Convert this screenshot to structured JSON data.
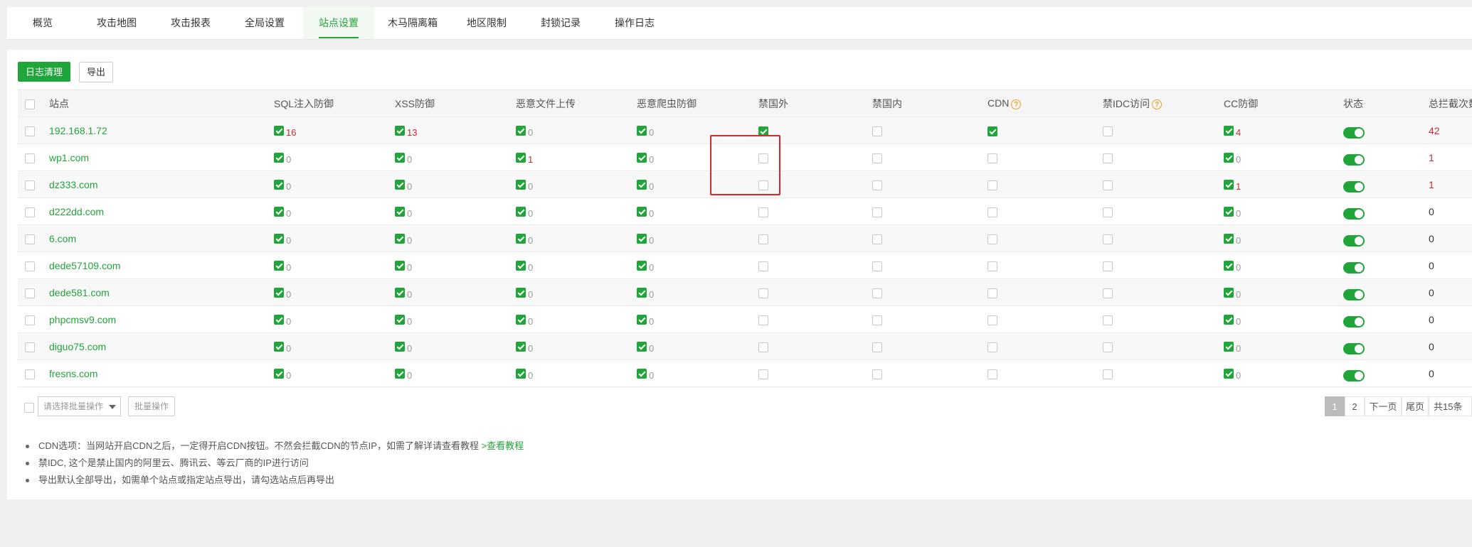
{
  "tabs": [
    "概览",
    "攻击地图",
    "攻击报表",
    "全局设置",
    "站点设置",
    "木马隔离箱",
    "地区限制",
    "封锁记录",
    "操作日志"
  ],
  "active_tab": 4,
  "toolbar": {
    "clear_logs": "日志清理",
    "export": "导出"
  },
  "table": {
    "headers": {
      "site": "站点",
      "sql": "SQL注入防御",
      "xss": "XSS防御",
      "upload": "恶意文件上传",
      "crawler": "恶意爬虫防御",
      "ban_foreign": "禁国外",
      "ban_domestic": "禁国内",
      "cdn": "CDN",
      "ban_idc": "禁IDC访问",
      "cc": "CC防御",
      "status": "状态",
      "total": "总拦截次数"
    },
    "rows": [
      {
        "site": "192.168.1.72",
        "sql": "16",
        "xss": "13",
        "upload": "0",
        "crawler": "0",
        "ban_foreign": true,
        "cdn": true,
        "cc": "4",
        "total": "42"
      },
      {
        "site": "wp1.com",
        "sql": "0",
        "xss": "0",
        "upload": "1",
        "crawler": "0",
        "ban_foreign": false,
        "cdn": false,
        "cc": "0",
        "total": "1"
      },
      {
        "site": "dz333.com",
        "sql": "0",
        "xss": "0",
        "upload": "0",
        "crawler": "0",
        "ban_foreign": false,
        "cdn": false,
        "cc": "1",
        "total": "1"
      },
      {
        "site": "d222dd.com",
        "sql": "0",
        "xss": "0",
        "upload": "0",
        "crawler": "0",
        "ban_foreign": false,
        "cdn": false,
        "cc": "0",
        "total": "0"
      },
      {
        "site": "6.com",
        "sql": "0",
        "xss": "0",
        "upload": "0",
        "crawler": "0",
        "ban_foreign": false,
        "cdn": false,
        "cc": "0",
        "total": "0"
      },
      {
        "site": "dede57109.com",
        "sql": "0",
        "xss": "0",
        "upload": "0",
        "crawler": "0",
        "ban_foreign": false,
        "cdn": false,
        "cc": "0",
        "total": "0"
      },
      {
        "site": "dede581.com",
        "sql": "0",
        "xss": "0",
        "upload": "0",
        "crawler": "0",
        "ban_foreign": false,
        "cdn": false,
        "cc": "0",
        "total": "0"
      },
      {
        "site": "phpcmsv9.com",
        "sql": "0",
        "xss": "0",
        "upload": "0",
        "crawler": "0",
        "ban_foreign": false,
        "cdn": false,
        "cc": "0",
        "total": "0"
      },
      {
        "site": "diguo75.com",
        "sql": "0",
        "xss": "0",
        "upload": "0",
        "crawler": "0",
        "ban_foreign": false,
        "cdn": false,
        "cc": "0",
        "total": "0"
      },
      {
        "site": "fresns.com",
        "sql": "0",
        "xss": "0",
        "upload": "0",
        "crawler": "0",
        "ban_foreign": false,
        "cdn": false,
        "cc": "0",
        "total": "0"
      }
    ]
  },
  "batch": {
    "select_placeholder": "请选择批量操作",
    "button": "批量操作"
  },
  "pager": {
    "page1": "1",
    "page2": "2",
    "next": "下一页",
    "last": "尾页",
    "total": "共15条"
  },
  "notes": [
    {
      "text": "CDN选项：当网站开启CDN之后，一定得开启CDN按钮。不然会拦截CDN的节点IP，如需了解详请查看教程 ",
      "link": ">查看教程"
    },
    {
      "text": "禁IDC, 这个是禁止国内的阿里云、腾讯云、等云厂商的IP进行访问"
    },
    {
      "text": "导出默认全部导出，如需单个站点或指定站点导出，请勾选站点后再导出"
    }
  ],
  "colors": {
    "accent": "#20a53a",
    "alert": "#cc2a2a",
    "highlight_box": "#e0242a",
    "help_icon": "#f0a020"
  }
}
